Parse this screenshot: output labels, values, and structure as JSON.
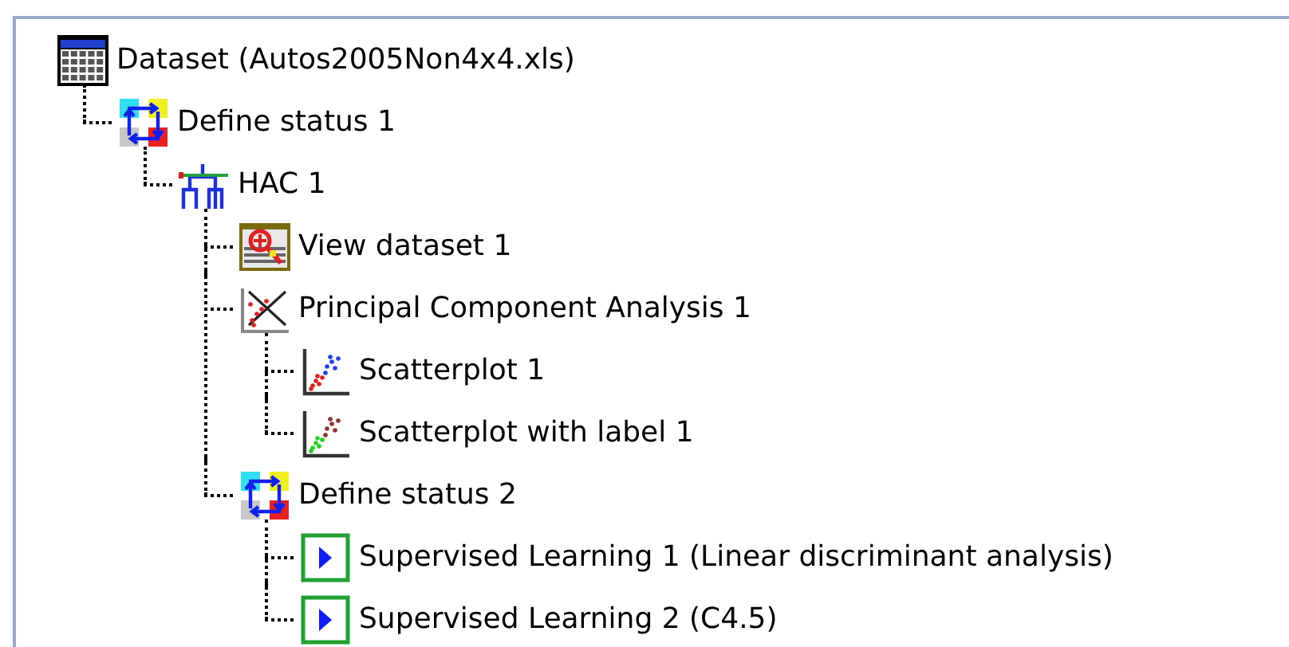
{
  "tree": [
    {
      "kind": "dataset",
      "label": "Dataset (Autos2005Non4x4.xls)",
      "children": [
        {
          "kind": "status",
          "label": "Define status 1",
          "children": [
            {
              "kind": "hac",
              "label": "HAC 1",
              "children": [
                {
                  "kind": "view",
                  "label": "View dataset 1"
                },
                {
                  "kind": "pca",
                  "label": "Principal Component Analysis 1",
                  "children": [
                    {
                      "kind": "scatter",
                      "label": "Scatterplot 1"
                    },
                    {
                      "kind": "scatter_label",
                      "label": "Scatterplot with label 1"
                    }
                  ]
                },
                {
                  "kind": "status",
                  "label": "Define status 2",
                  "children": [
                    {
                      "kind": "supervised",
                      "label": "Supervised Learning 1 (Linear discriminant analysis)"
                    },
                    {
                      "kind": "supervised",
                      "label": "Supervised Learning 2 (C4.5)"
                    }
                  ]
                }
              ]
            }
          ]
        }
      ]
    }
  ]
}
